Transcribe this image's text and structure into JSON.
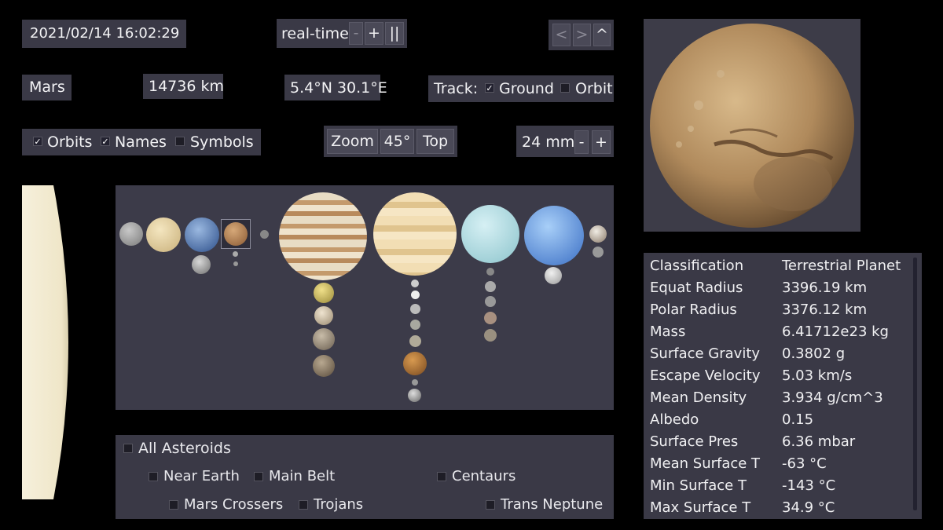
{
  "time": {
    "datetime": "2021/02/14  16:02:29",
    "rate": "real-time",
    "minus": "-",
    "plus": "+",
    "pause": "||"
  },
  "nav": {
    "prev": "<",
    "next": ">",
    "up": "^"
  },
  "target": {
    "name": "Mars",
    "distance": "14736 km",
    "coords": "5.4°N 30.1°E"
  },
  "track": {
    "label": "Track:",
    "ground": "Ground",
    "orbit": "Orbit"
  },
  "view": {
    "orbits": "Orbits",
    "names": "Names",
    "symbols": "Symbols",
    "zoom": "Zoom",
    "angle": "45°",
    "top": "Top",
    "lens": "24 mm",
    "lens_minus": "-",
    "lens_plus": "+"
  },
  "asteroids": {
    "all": "All Asteroids",
    "near_earth": "Near Earth",
    "main_belt": "Main Belt",
    "centaurs": "Centaurs",
    "mars_crossers": "Mars Crossers",
    "trojans": "Trojans",
    "trans_neptune": "Trans Neptune"
  },
  "info": [
    {
      "k": "Classification",
      "v": "Terrestrial Planet"
    },
    {
      "k": "Equat Radius",
      "v": "3396.19 km"
    },
    {
      "k": "Polar Radius",
      "v": "3376.12 km"
    },
    {
      "k": "Mass",
      "v": "6.41712e23 kg"
    },
    {
      "k": "Surface Gravity",
      "v": "0.3802 g"
    },
    {
      "k": "Escape Velocity",
      "v": "5.03 km/s"
    },
    {
      "k": "Mean Density",
      "v": "3.934 g/cm^3"
    },
    {
      "k": "Albedo",
      "v": "0.15"
    },
    {
      "k": "Surface Pres",
      "v": "6.36 mbar"
    },
    {
      "k": "Mean Surface T",
      "v": "-63 °C"
    },
    {
      "k": "Min Surface T",
      "v": "-143 °C"
    },
    {
      "k": "Max Surface T",
      "v": "34.9 °C"
    }
  ],
  "colors": {
    "panel": "#3a3946",
    "background": "#000000",
    "mars": "#b08a5c"
  },
  "icons": {
    "check": "✓"
  }
}
